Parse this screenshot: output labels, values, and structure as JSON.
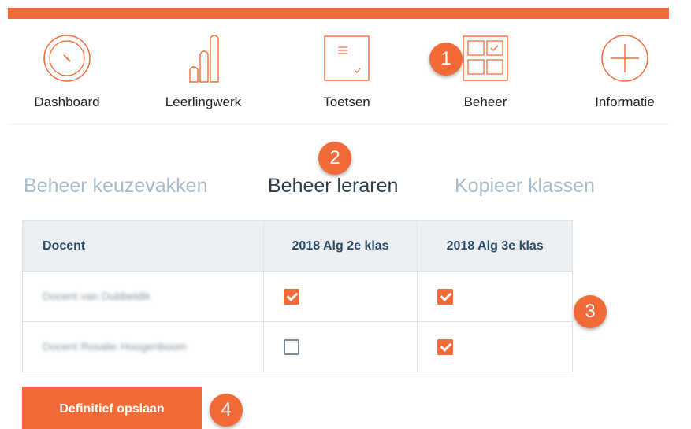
{
  "colors": {
    "accent": "#f26a37",
    "tab_inactive": "#a9bcc8",
    "tab_active": "#2d3e4e",
    "table_header_bg": "#eceff1"
  },
  "nav": {
    "items": [
      {
        "label": "Dashboard",
        "icon": "dashboard-gauge-icon"
      },
      {
        "label": "Leerlingwerk",
        "icon": "bar-chart-icon"
      },
      {
        "label": "Toetsen",
        "icon": "document-check-icon"
      },
      {
        "label": "Beheer",
        "icon": "grid-check-icon"
      },
      {
        "label": "Informatie",
        "icon": "plus-circle-icon"
      }
    ]
  },
  "badges": [
    "1",
    "2",
    "3",
    "4"
  ],
  "tabs": [
    {
      "label": "Beheer keuzevakken",
      "active": false
    },
    {
      "label": "Beheer leraren",
      "active": true
    },
    {
      "label": "Kopieer klassen",
      "active": false
    }
  ],
  "table": {
    "headers": [
      "Docent",
      "2018 Alg 2e klas",
      "2018 Alg 3e klas"
    ],
    "rows": [
      {
        "docent": "Docent van Dubbeldik",
        "checks": [
          true,
          true
        ]
      },
      {
        "docent": "Docent Rosalie Hoogenboom",
        "checks": [
          false,
          true
        ]
      }
    ]
  },
  "save_label": "Definitief opslaan"
}
